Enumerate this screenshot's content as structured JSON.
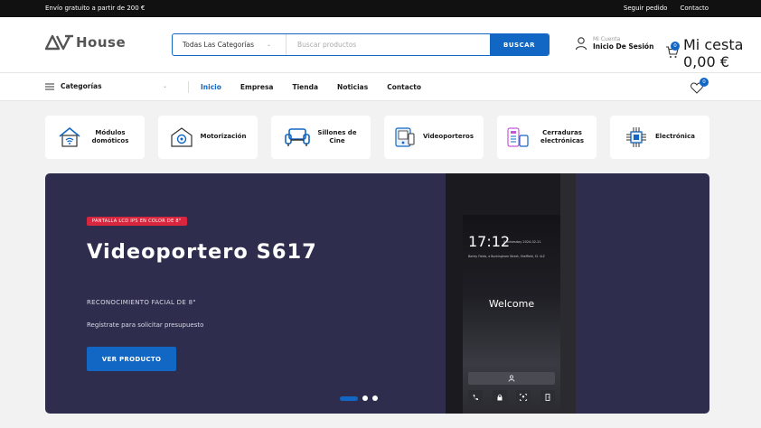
{
  "topbar": {
    "promo": "Envío gratuito a partir de 200 €",
    "links": [
      "Seguir pedido",
      "Contacto"
    ]
  },
  "header": {
    "logo_text": "House",
    "search": {
      "category": "Todas Las Categorías",
      "placeholder": "Buscar productos",
      "button": "BUSCAR"
    },
    "account": {
      "small": "Mi Cuenta",
      "label": "Inicio De Sesión"
    },
    "cart": {
      "small": "Mi cesta",
      "total": "0,00 €",
      "count": "0"
    }
  },
  "nav": {
    "categories_label": "Categorías",
    "links": [
      "Inicio",
      "Empresa",
      "Tienda",
      "Noticias",
      "Contacto"
    ],
    "wishlist_count": "0"
  },
  "categories": [
    {
      "label": "Módulos domóticos",
      "icon": "smart-home-icon"
    },
    {
      "label": "Motorización",
      "icon": "garage-motor-icon"
    },
    {
      "label": "Sillones de Cine",
      "icon": "armchair-icon"
    },
    {
      "label": "Videoporteros",
      "icon": "video-intercom-icon"
    },
    {
      "label": "Cerraduras electrónicas",
      "icon": "smart-lock-icon"
    },
    {
      "label": "Electrónica",
      "icon": "chip-icon"
    }
  ],
  "banner": {
    "tag": "PANTALLA LCD IPS EN COLOR DE 8\"",
    "title": "Videoportero S617",
    "subtitle": "RECONOCIMIENTO FACIAL DE 8\"",
    "note": "Regístrate para solicitar presupuesto",
    "button": "VER PRODUCTO",
    "device": {
      "time": "17:12",
      "date": "Wednesday 2024-02-21",
      "address": "Barley Fields, a Buckingham Street, Sheffield, S1 4LZ",
      "welcome": "Welcome"
    }
  },
  "colors": {
    "accent": "#1267c4",
    "banner_bg": "#2e2d4d",
    "tag": "#d7263d"
  }
}
